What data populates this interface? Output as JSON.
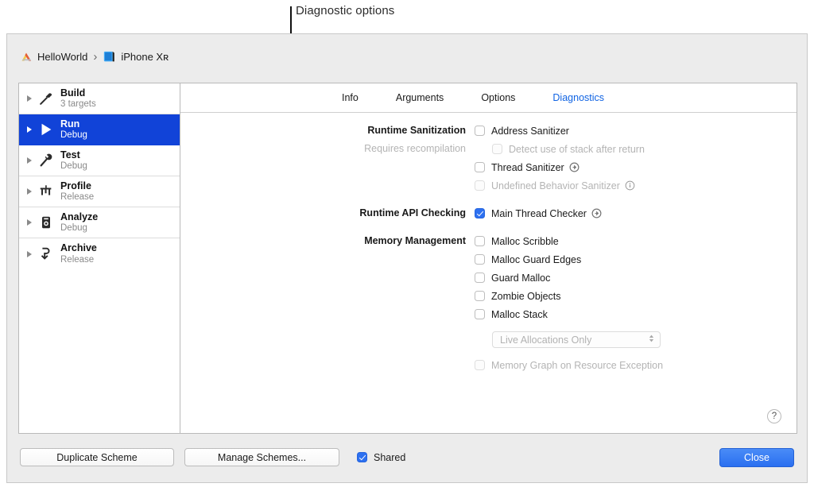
{
  "annotation": {
    "label": "Diagnostic options"
  },
  "toolbar": {
    "project_name": "HelloWorld",
    "separator": "›",
    "device_name": "iPhone Xʀ",
    "project_icon": "xcode-icon",
    "device_icon": "iphone-icon"
  },
  "sidebar": {
    "items": [
      {
        "name": "Build",
        "sub": "3 targets",
        "icon": "hammer-icon",
        "selected": false
      },
      {
        "name": "Run",
        "sub": "Debug",
        "icon": "play-icon",
        "selected": true
      },
      {
        "name": "Test",
        "sub": "Debug",
        "icon": "wrench-icon",
        "selected": false
      },
      {
        "name": "Profile",
        "sub": "Release",
        "icon": "gauge-icon",
        "selected": false
      },
      {
        "name": "Analyze",
        "sub": "Debug",
        "icon": "magnifier-icon",
        "selected": false
      },
      {
        "name": "Archive",
        "sub": "Release",
        "icon": "archive-box-icon",
        "selected": false
      }
    ]
  },
  "tabs": [
    {
      "label": "Info",
      "active": false
    },
    {
      "label": "Arguments",
      "active": false
    },
    {
      "label": "Options",
      "active": false
    },
    {
      "label": "Diagnostics",
      "active": true
    }
  ],
  "form": {
    "runtime_sanitization": {
      "label": "Runtime Sanitization",
      "sublabel": "Requires recompilation",
      "options": [
        {
          "label": "Address Sanitizer",
          "checked": false,
          "disabled": false,
          "indent": false,
          "icon": null
        },
        {
          "label": "Detect use of stack after return",
          "checked": false,
          "disabled": true,
          "indent": true,
          "icon": null
        },
        {
          "label": "Thread Sanitizer",
          "checked": false,
          "disabled": false,
          "indent": false,
          "icon": "arrow-circle-icon"
        },
        {
          "label": "Undefined Behavior Sanitizer",
          "checked": false,
          "disabled": true,
          "indent": false,
          "icon": "info-circle-icon"
        }
      ]
    },
    "runtime_api_checking": {
      "label": "Runtime API Checking",
      "options": [
        {
          "label": "Main Thread Checker",
          "checked": true,
          "disabled": false,
          "indent": false,
          "icon": "arrow-circle-icon"
        }
      ]
    },
    "memory_management": {
      "label": "Memory Management",
      "options": [
        {
          "label": "Malloc Scribble",
          "checked": false,
          "disabled": false,
          "indent": false,
          "icon": null
        },
        {
          "label": "Malloc Guard Edges",
          "checked": false,
          "disabled": false,
          "indent": false,
          "icon": null
        },
        {
          "label": "Guard Malloc",
          "checked": false,
          "disabled": false,
          "indent": false,
          "icon": null
        },
        {
          "label": "Zombie Objects",
          "checked": false,
          "disabled": false,
          "indent": false,
          "icon": null
        },
        {
          "label": "Malloc Stack",
          "checked": false,
          "disabled": false,
          "indent": false,
          "icon": null
        }
      ],
      "select": {
        "value": "Live Allocations Only",
        "disabled": true,
        "icon": "updown-chevron-icon"
      },
      "trailing_option": {
        "label": "Memory Graph on Resource Exception",
        "checked": false,
        "disabled": true
      }
    },
    "help_button": "?"
  },
  "bottom": {
    "duplicate_scheme": "Duplicate Scheme",
    "manage_schemes": "Manage Schemes...",
    "shared_label": "Shared",
    "shared_checked": true,
    "close": "Close"
  },
  "colors": {
    "accent_blue": "#1164e3",
    "selection_blue": "#1143d8",
    "checkbox_blue": "#2d70f0",
    "close_button_blue": "#2a6ff0",
    "window_chrome": "#ececec",
    "disabled_text": "#b4b4b4"
  }
}
